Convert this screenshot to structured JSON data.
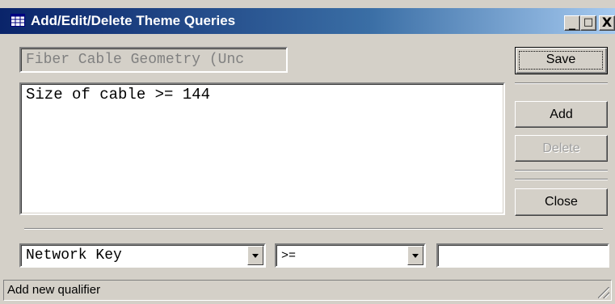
{
  "window": {
    "title": "Add/Edit/Delete Theme Queries",
    "icon": "table-icon",
    "controls": {
      "minimize": "_",
      "maximize": "□",
      "close": "X"
    }
  },
  "theme_name_field": {
    "value": "Fiber Cable Geometry (Unc"
  },
  "query_text": {
    "value": "Size of cable >= 144"
  },
  "buttons": {
    "save": "Save",
    "add": "Add",
    "delete": "Delete",
    "close": "Close"
  },
  "qualifier": {
    "field_combo": {
      "selected": "Network Key"
    },
    "operator_combo": {
      "selected": ">="
    },
    "value_input": {
      "value": ""
    }
  },
  "statusbar": {
    "text": "Add new qualifier"
  },
  "colors": {
    "title_start": "#0a246a",
    "title_end": "#a6caf0",
    "face": "#d4d0c8"
  }
}
